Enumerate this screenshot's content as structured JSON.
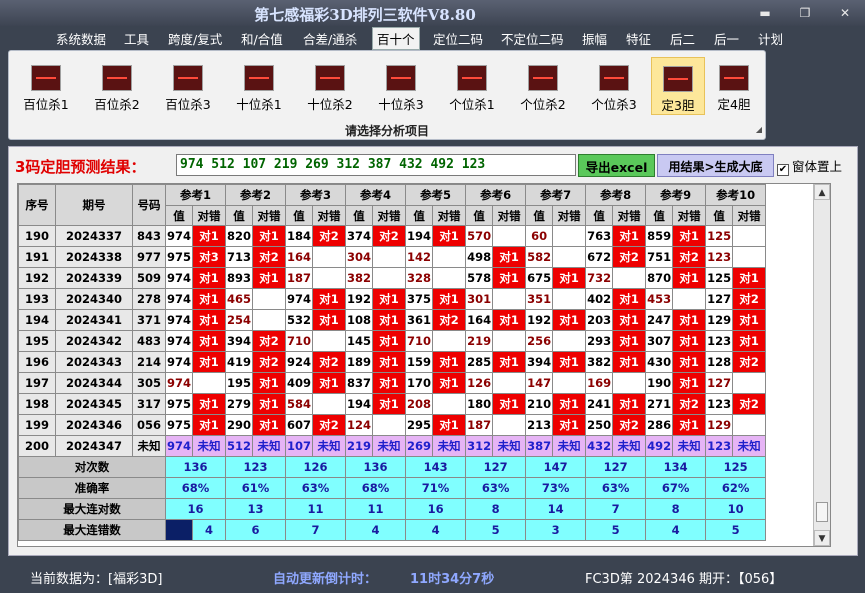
{
  "window": {
    "title": "第七感福彩3D排列三软件V8.80",
    "min": "▬",
    "max": "❐",
    "close": "✕"
  },
  "menu": [
    "系统数据",
    "工具",
    "跨度/复式",
    "和/合值",
    "合差/通杀",
    "百十个",
    "定位二码",
    "不定位二码",
    "振幅",
    "特征",
    "后二",
    "后一",
    "计划"
  ],
  "ribbon": {
    "buttons": [
      "百位杀1",
      "百位杀2",
      "百位杀3",
      "十位杀1",
      "十位杀2",
      "十位杀3",
      "个位杀1",
      "个位杀2",
      "个位杀3",
      "定3胆",
      "定4胆"
    ],
    "selected": "定3胆",
    "caption": "请选择分析项目",
    "icon": "chart-icon"
  },
  "predict": {
    "label": "3码定胆预测结果：",
    "value": "974 512 107 219 269 312 387 432 492 123",
    "export_label": "导出excel",
    "results_label": "用结果>生成大底",
    "topmost_label": "窗体置上",
    "topmost_checked": "✔"
  },
  "table": {
    "col_seq": "序号",
    "col_issue": "期号",
    "col_code": "号码",
    "refs": [
      "参考1",
      "参考2",
      "参考3",
      "参考4",
      "参考5",
      "参考6",
      "参考7",
      "参考8",
      "参考9",
      "参考10"
    ],
    "sub_val": "值",
    "sub_hit": "对错",
    "rows": [
      {
        "seq": "190",
        "issue": "2024337",
        "code": "843",
        "cells": [
          [
            "974",
            "对1"
          ],
          [
            "820",
            "对1"
          ],
          [
            "184",
            "对2"
          ],
          [
            "374",
            "对2"
          ],
          [
            "194",
            "对1"
          ],
          [
            "570",
            ""
          ],
          [
            "60",
            ""
          ],
          [
            "763",
            "对1"
          ],
          [
            "859",
            "对1"
          ],
          [
            "125",
            ""
          ]
        ]
      },
      {
        "seq": "191",
        "issue": "2024338",
        "code": "977",
        "cells": [
          [
            "975",
            "对3"
          ],
          [
            "713",
            "对2"
          ],
          [
            "164",
            ""
          ],
          [
            "304",
            ""
          ],
          [
            "142",
            ""
          ],
          [
            "498",
            "对1"
          ],
          [
            "582",
            ""
          ],
          [
            "672",
            "对2"
          ],
          [
            "751",
            "对2"
          ],
          [
            "123",
            ""
          ]
        ]
      },
      {
        "seq": "192",
        "issue": "2024339",
        "code": "509",
        "cells": [
          [
            "974",
            "对1"
          ],
          [
            "893",
            "对1"
          ],
          [
            "187",
            ""
          ],
          [
            "382",
            ""
          ],
          [
            "328",
            ""
          ],
          [
            "578",
            "对1"
          ],
          [
            "675",
            "对1"
          ],
          [
            "732",
            ""
          ],
          [
            "870",
            "对1"
          ],
          [
            "125",
            "对1"
          ]
        ]
      },
      {
        "seq": "193",
        "issue": "2024340",
        "code": "278",
        "cells": [
          [
            "974",
            "对1"
          ],
          [
            "465",
            ""
          ],
          [
            "974",
            "对1"
          ],
          [
            "192",
            "对1"
          ],
          [
            "375",
            "对1"
          ],
          [
            "301",
            ""
          ],
          [
            "351",
            ""
          ],
          [
            "402",
            "对1"
          ],
          [
            "453",
            ""
          ],
          [
            "127",
            "对2"
          ]
        ]
      },
      {
        "seq": "194",
        "issue": "2024341",
        "code": "371",
        "cells": [
          [
            "974",
            "对1"
          ],
          [
            "254",
            ""
          ],
          [
            "532",
            "对1"
          ],
          [
            "108",
            "对1"
          ],
          [
            "361",
            "对2"
          ],
          [
            "164",
            "对1"
          ],
          [
            "192",
            "对1"
          ],
          [
            "203",
            "对1"
          ],
          [
            "247",
            "对1"
          ],
          [
            "129",
            "对1"
          ]
        ]
      },
      {
        "seq": "195",
        "issue": "2024342",
        "code": "483",
        "cells": [
          [
            "974",
            "对1"
          ],
          [
            "394",
            "对2"
          ],
          [
            "710",
            ""
          ],
          [
            "145",
            "对1"
          ],
          [
            "710",
            ""
          ],
          [
            "219",
            ""
          ],
          [
            "256",
            ""
          ],
          [
            "293",
            "对1"
          ],
          [
            "307",
            "对1"
          ],
          [
            "123",
            "对1"
          ]
        ]
      },
      {
        "seq": "196",
        "issue": "2024343",
        "code": "214",
        "cells": [
          [
            "974",
            "对1"
          ],
          [
            "419",
            "对2"
          ],
          [
            "924",
            "对2"
          ],
          [
            "189",
            "对1"
          ],
          [
            "159",
            "对1"
          ],
          [
            "285",
            "对1"
          ],
          [
            "394",
            "对1"
          ],
          [
            "382",
            "对1"
          ],
          [
            "430",
            "对1"
          ],
          [
            "128",
            "对2"
          ]
        ]
      },
      {
        "seq": "197",
        "issue": "2024344",
        "code": "305",
        "cells": [
          [
            "974",
            ""
          ],
          [
            "195",
            "对1"
          ],
          [
            "409",
            "对1"
          ],
          [
            "837",
            "对1"
          ],
          [
            "170",
            "对1"
          ],
          [
            "126",
            ""
          ],
          [
            "147",
            ""
          ],
          [
            "169",
            ""
          ],
          [
            "190",
            "对1"
          ],
          [
            "127",
            ""
          ]
        ]
      },
      {
        "seq": "198",
        "issue": "2024345",
        "code": "317",
        "cells": [
          [
            "975",
            "对1"
          ],
          [
            "279",
            "对1"
          ],
          [
            "584",
            ""
          ],
          [
            "194",
            "对1"
          ],
          [
            "208",
            ""
          ],
          [
            "180",
            "对1"
          ],
          [
            "210",
            "对1"
          ],
          [
            "241",
            "对1"
          ],
          [
            "271",
            "对2"
          ],
          [
            "123",
            "对2"
          ]
        ]
      },
      {
        "seq": "199",
        "issue": "2024346",
        "code": "056",
        "cells": [
          [
            "975",
            "对1"
          ],
          [
            "290",
            "对1"
          ],
          [
            "607",
            "对2"
          ],
          [
            "124",
            ""
          ],
          [
            "295",
            "对1"
          ],
          [
            "187",
            ""
          ],
          [
            "213",
            "对1"
          ],
          [
            "250",
            "对2"
          ],
          [
            "286",
            "对1"
          ],
          [
            "129",
            ""
          ]
        ]
      }
    ],
    "pred_row": {
      "seq": "200",
      "issue": "2024347",
      "code": "未知",
      "cells": [
        [
          "974",
          "未知"
        ],
        [
          "512",
          "未知"
        ],
        [
          "107",
          "未知"
        ],
        [
          "219",
          "未知"
        ],
        [
          "269",
          "未知"
        ],
        [
          "312",
          "未知"
        ],
        [
          "387",
          "未知"
        ],
        [
          "432",
          "未知"
        ],
        [
          "492",
          "未知"
        ],
        [
          "123",
          "未知"
        ]
      ]
    },
    "stats": [
      {
        "label": "对次数",
        "values": [
          "136",
          "123",
          "126",
          "136",
          "143",
          "127",
          "147",
          "127",
          "134",
          "125"
        ]
      },
      {
        "label": "准确率",
        "values": [
          "68%",
          "61%",
          "63%",
          "68%",
          "71%",
          "63%",
          "73%",
          "63%",
          "67%",
          "62%"
        ]
      },
      {
        "label": "最大连对数",
        "values": [
          "16",
          "13",
          "11",
          "11",
          "16",
          "8",
          "14",
          "7",
          "8",
          "10"
        ]
      },
      {
        "label": "最大连错数",
        "values": [
          "4",
          "6",
          "7",
          "4",
          "4",
          "5",
          "3",
          "5",
          "4",
          "5"
        ]
      }
    ]
  },
  "status": {
    "current": "当前数据为：[福彩3D]",
    "countdown_label": "自动更新倒计时：",
    "countdown_value": "11时34分7秒",
    "issue_info": "FC3D第 2024346 期开：【056】"
  },
  "colors": {
    "hit": "#ee0000",
    "stat": "#80ffff",
    "pred": "#e6b4f5",
    "export": "#5ac85a"
  }
}
